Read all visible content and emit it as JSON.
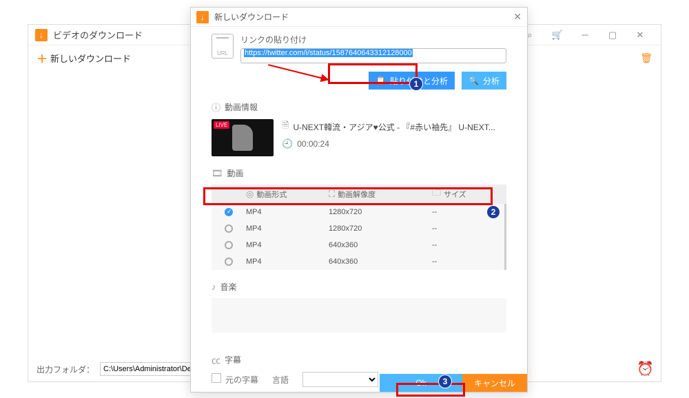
{
  "main_window": {
    "title": "ビデオのダウンロード",
    "new_download": "新しいダウンロード",
    "output_folder_label": "出力フォルダ：",
    "output_folder_value": "C:\\Users\\Administrator\\Desktop",
    "browse": "..."
  },
  "modal": {
    "title": "新しいダウンロード",
    "link_paste_label": "リンクの貼り付け",
    "url_value": "https://twitter.com/i/status/1587640643312128000",
    "url_badge": "URL",
    "paste_analyze_btn": "貼り付けと分析",
    "analyze_btn": "分析",
    "video_info_h": "動画情報",
    "live_tag": "LIVE",
    "video_title": "U-NEXT韓流・アジア♥公式 - 『#赤い袖先』 U-NEXT...",
    "duration": "00:00:24",
    "video_h": "動画",
    "col_format": "動画形式",
    "col_res": "動画解像度",
    "col_size": "サイズ",
    "rows": [
      {
        "selected": true,
        "format": "MP4",
        "res": "1280x720",
        "size": "--"
      },
      {
        "selected": false,
        "format": "MP4",
        "res": "1280x720",
        "size": "--"
      },
      {
        "selected": false,
        "format": "MP4",
        "res": "640x360",
        "size": "--"
      },
      {
        "selected": false,
        "format": "MP4",
        "res": "640x360",
        "size": "--"
      }
    ],
    "audio_h": "音楽",
    "subtitle_h": "字幕",
    "orig_sub": "元の字幕",
    "lang_label": "言語",
    "ok": "Ok",
    "cancel": "キャンセル"
  }
}
